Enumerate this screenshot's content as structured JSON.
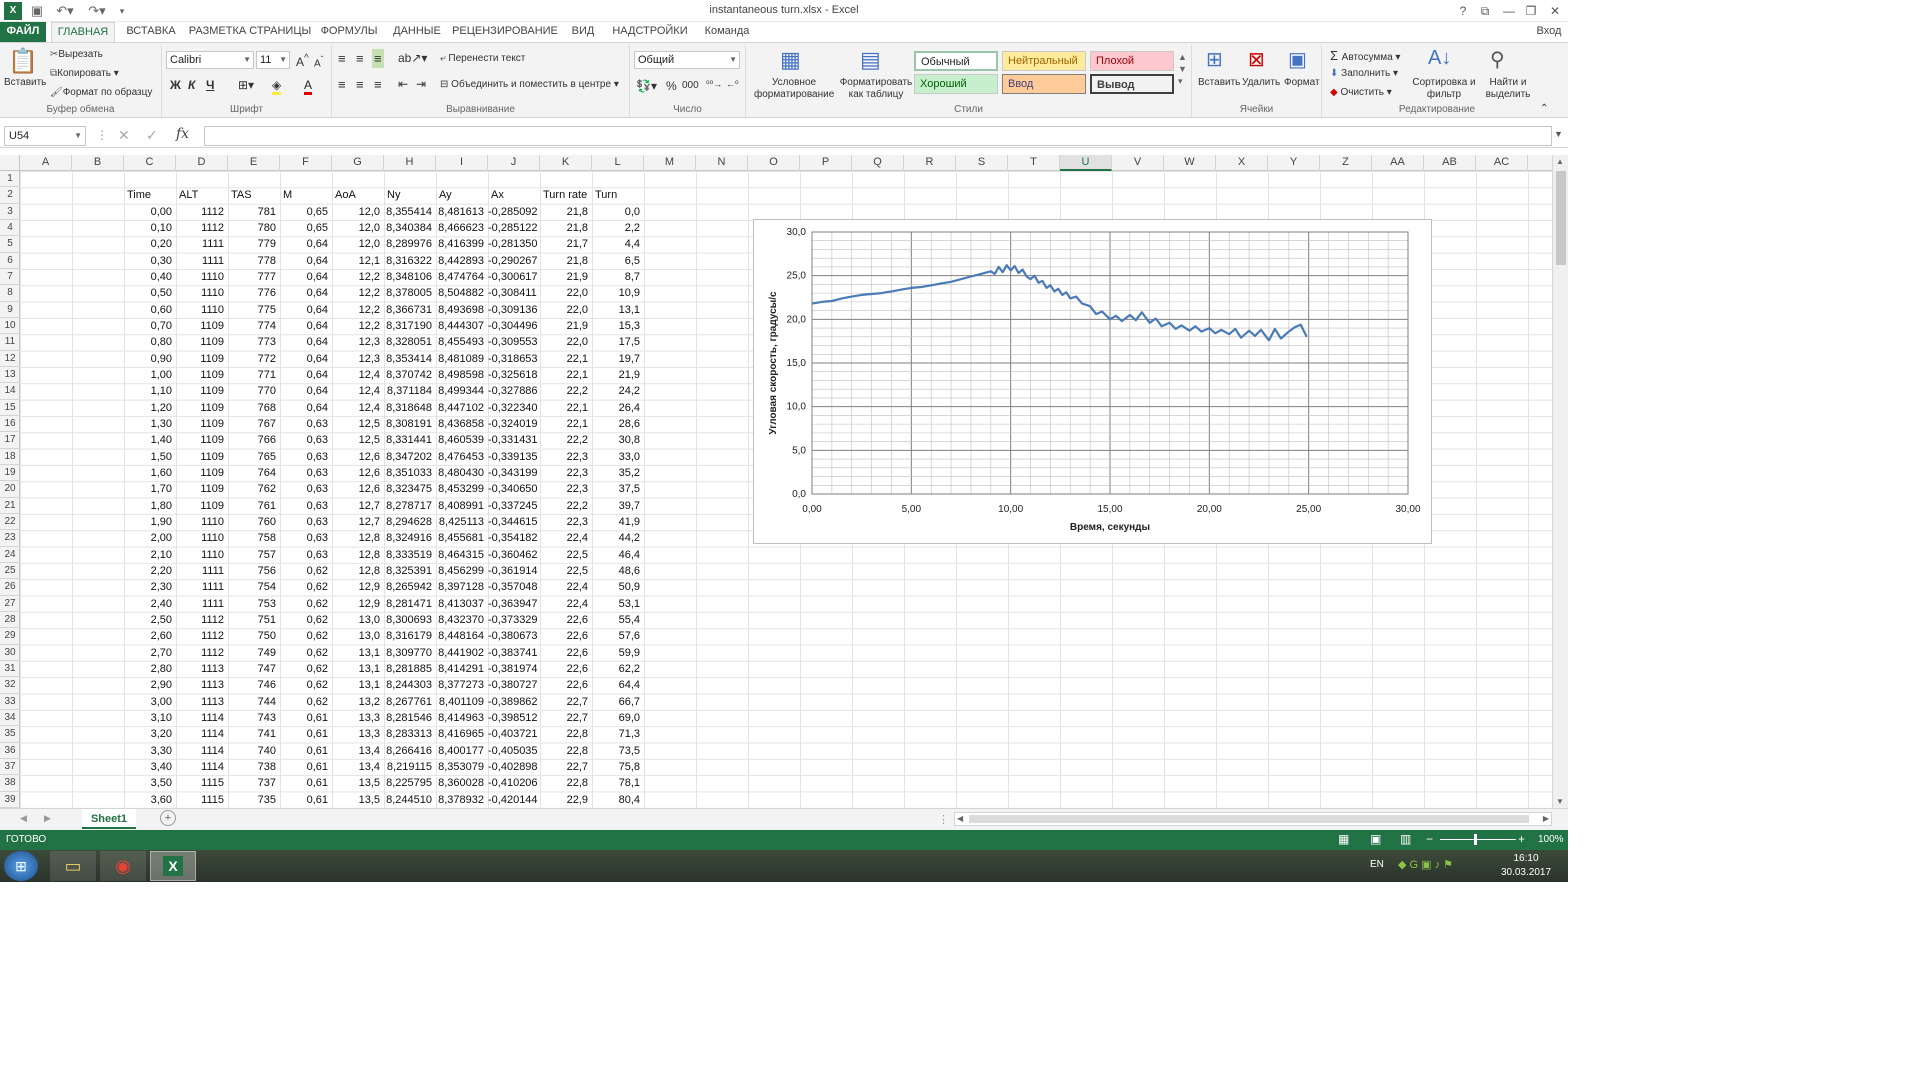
{
  "window": {
    "title": "instantaneous turn.xlsx - Excel",
    "login": "Вход"
  },
  "titlebar_icons": {
    "help": "?",
    "minimize": "—",
    "restore": "❐",
    "close": "✕"
  },
  "tabs": [
    "ФАЙЛ",
    "ГЛАВНАЯ",
    "ВСТАВКА",
    "РАЗМЕТКА СТРАНИЦЫ",
    "ФОРМУЛЫ",
    "ДАННЫЕ",
    "РЕЦЕНЗИРОВАНИЕ",
    "ВИД",
    "НАДСТРОЙКИ",
    "Команда"
  ],
  "ribbon": {
    "clipboard": {
      "paste": "Вставить",
      "cut": "Вырезать",
      "copy": "Копировать",
      "format_painter": "Формат по образцу",
      "group": "Буфер обмена"
    },
    "font": {
      "name": "Calibri",
      "size": "11",
      "bold": "Ж",
      "italic": "К",
      "underline": "Ч",
      "group": "Шрифт"
    },
    "alignment": {
      "wrap": "Перенести текст",
      "merge": "Объединить и поместить в центре",
      "group": "Выравнивание"
    },
    "number": {
      "format": "Общий",
      "percent": "%",
      "thousands": "000",
      "group": "Число"
    },
    "styles": {
      "conditional": "Условное форматирование",
      "as_table": "Форматировать как таблицу",
      "normal": "Обычный",
      "neutral": "Нейтральный",
      "bad": "Плохой",
      "good": "Хороший",
      "input": "Ввод",
      "output": "Вывод",
      "group": "Стили"
    },
    "cells": {
      "insert": "Вставить",
      "delete": "Удалить",
      "format": "Формат",
      "group": "Ячейки"
    },
    "editing": {
      "autosum": "Автосумма",
      "fill": "Заполнить",
      "clear": "Очистить",
      "sort": "Сортировка и фильтр",
      "find": "Найти и выделить",
      "group": "Редактирование"
    }
  },
  "formula_bar": {
    "name_box": "U54",
    "fx": "fx",
    "value": ""
  },
  "columns": [
    "A",
    "B",
    "C",
    "D",
    "E",
    "F",
    "G",
    "H",
    "I",
    "J",
    "K",
    "L",
    "M",
    "N",
    "O",
    "P",
    "Q",
    "R",
    "S",
    "T",
    "U",
    "V",
    "W",
    "X",
    "Y",
    "Z",
    "AA",
    "AB",
    "AC"
  ],
  "selected_column": "U",
  "headers": [
    "Time",
    "ALT",
    "TAS",
    "M",
    "AoA",
    "Ny",
    "Ay",
    "Ax",
    "Turn rate",
    "Turn"
  ],
  "rows": [
    [
      "0,00",
      "1112",
      "781",
      "0,65",
      "12,0",
      "8,355414",
      "8,481613",
      "-0,285092",
      "21,8",
      "0,0"
    ],
    [
      "0,10",
      "1112",
      "780",
      "0,65",
      "12,0",
      "8,340384",
      "8,466623",
      "-0,285122",
      "21,8",
      "2,2"
    ],
    [
      "0,20",
      "1111",
      "779",
      "0,64",
      "12,0",
      "8,289976",
      "8,416399",
      "-0,281350",
      "21,7",
      "4,4"
    ],
    [
      "0,30",
      "1111",
      "778",
      "0,64",
      "12,1",
      "8,316322",
      "8,442893",
      "-0,290267",
      "21,8",
      "6,5"
    ],
    [
      "0,40",
      "1110",
      "777",
      "0,64",
      "12,2",
      "8,348106",
      "8,474764",
      "-0,300617",
      "21,9",
      "8,7"
    ],
    [
      "0,50",
      "1110",
      "776",
      "0,64",
      "12,2",
      "8,378005",
      "8,504882",
      "-0,308411",
      "22,0",
      "10,9"
    ],
    [
      "0,60",
      "1110",
      "775",
      "0,64",
      "12,2",
      "8,366731",
      "8,493698",
      "-0,309136",
      "22,0",
      "13,1"
    ],
    [
      "0,70",
      "1109",
      "774",
      "0,64",
      "12,2",
      "8,317190",
      "8,444307",
      "-0,304496",
      "21,9",
      "15,3"
    ],
    [
      "0,80",
      "1109",
      "773",
      "0,64",
      "12,3",
      "8,328051",
      "8,455493",
      "-0,309553",
      "22,0",
      "17,5"
    ],
    [
      "0,90",
      "1109",
      "772",
      "0,64",
      "12,3",
      "8,353414",
      "8,481089",
      "-0,318653",
      "22,1",
      "19,7"
    ],
    [
      "1,00",
      "1109",
      "771",
      "0,64",
      "12,4",
      "8,370742",
      "8,498598",
      "-0,325618",
      "22,1",
      "21,9"
    ],
    [
      "1,10",
      "1109",
      "770",
      "0,64",
      "12,4",
      "8,371184",
      "8,499344",
      "-0,327886",
      "22,2",
      "24,2"
    ],
    [
      "1,20",
      "1109",
      "768",
      "0,64",
      "12,4",
      "8,318648",
      "8,447102",
      "-0,322340",
      "22,1",
      "26,4"
    ],
    [
      "1,30",
      "1109",
      "767",
      "0,63",
      "12,5",
      "8,308191",
      "8,436858",
      "-0,324019",
      "22,1",
      "28,6"
    ],
    [
      "1,40",
      "1109",
      "766",
      "0,63",
      "12,5",
      "8,331441",
      "8,460539",
      "-0,331431",
      "22,2",
      "30,8"
    ],
    [
      "1,50",
      "1109",
      "765",
      "0,63",
      "12,6",
      "8,347202",
      "8,476453",
      "-0,339135",
      "22,3",
      "33,0"
    ],
    [
      "1,60",
      "1109",
      "764",
      "0,63",
      "12,6",
      "8,351033",
      "8,480430",
      "-0,343199",
      "22,3",
      "35,2"
    ],
    [
      "1,70",
      "1109",
      "762",
      "0,63",
      "12,6",
      "8,323475",
      "8,453299",
      "-0,340650",
      "22,3",
      "37,5"
    ],
    [
      "1,80",
      "1109",
      "761",
      "0,63",
      "12,7",
      "8,278717",
      "8,408991",
      "-0,337245",
      "22,2",
      "39,7"
    ],
    [
      "1,90",
      "1110",
      "760",
      "0,63",
      "12,7",
      "8,294628",
      "8,425113",
      "-0,344615",
      "22,3",
      "41,9"
    ],
    [
      "2,00",
      "1110",
      "758",
      "0,63",
      "12,8",
      "8,324916",
      "8,455681",
      "-0,354182",
      "22,4",
      "44,2"
    ],
    [
      "2,10",
      "1110",
      "757",
      "0,63",
      "12,8",
      "8,333519",
      "8,464315",
      "-0,360462",
      "22,5",
      "46,4"
    ],
    [
      "2,20",
      "1111",
      "756",
      "0,62",
      "12,8",
      "8,325391",
      "8,456299",
      "-0,361914",
      "22,5",
      "48,6"
    ],
    [
      "2,30",
      "1111",
      "754",
      "0,62",
      "12,9",
      "8,265942",
      "8,397128",
      "-0,357048",
      "22,4",
      "50,9"
    ],
    [
      "2,40",
      "1111",
      "753",
      "0,62",
      "12,9",
      "8,281471",
      "8,413037",
      "-0,363947",
      "22,4",
      "53,1"
    ],
    [
      "2,50",
      "1112",
      "751",
      "0,62",
      "13,0",
      "8,300693",
      "8,432370",
      "-0,373329",
      "22,6",
      "55,4"
    ],
    [
      "2,60",
      "1112",
      "750",
      "0,62",
      "13,0",
      "8,316179",
      "8,448164",
      "-0,380673",
      "22,6",
      "57,6"
    ],
    [
      "2,70",
      "1112",
      "749",
      "0,62",
      "13,1",
      "8,309770",
      "8,441902",
      "-0,383741",
      "22,6",
      "59,9"
    ],
    [
      "2,80",
      "1113",
      "747",
      "0,62",
      "13,1",
      "8,281885",
      "8,414291",
      "-0,381974",
      "22,6",
      "62,2"
    ],
    [
      "2,90",
      "1113",
      "746",
      "0,62",
      "13,1",
      "8,244303",
      "8,377273",
      "-0,380727",
      "22,6",
      "64,4"
    ],
    [
      "3,00",
      "1113",
      "744",
      "0,62",
      "13,2",
      "8,267761",
      "8,401109",
      "-0,389862",
      "22,7",
      "66,7"
    ],
    [
      "3,10",
      "1114",
      "743",
      "0,61",
      "13,3",
      "8,281546",
      "8,414963",
      "-0,398512",
      "22,7",
      "69,0"
    ],
    [
      "3,20",
      "1114",
      "741",
      "0,61",
      "13,3",
      "8,283313",
      "8,416965",
      "-0,403721",
      "22,8",
      "71,3"
    ],
    [
      "3,30",
      "1114",
      "740",
      "0,61",
      "13,4",
      "8,266416",
      "8,400177",
      "-0,405035",
      "22,8",
      "73,5"
    ],
    [
      "3,40",
      "1114",
      "738",
      "0,61",
      "13,4",
      "8,219115",
      "8,353079",
      "-0,402898",
      "22,7",
      "75,8"
    ],
    [
      "3,50",
      "1115",
      "737",
      "0,61",
      "13,5",
      "8,225795",
      "8,360028",
      "-0,410206",
      "22,8",
      "78,1"
    ],
    [
      "3,60",
      "1115",
      "735",
      "0,61",
      "13,5",
      "8,244510",
      "8,378932",
      "-0,420144",
      "22,9",
      "80,4"
    ]
  ],
  "chart_data": {
    "type": "line",
    "title": "",
    "xlabel": "Время, секунды",
    "ylabel": "Угловая скорость, градусы/с",
    "xlim": [
      0,
      30
    ],
    "ylim": [
      0,
      30
    ],
    "x_ticks": [
      "0,00",
      "5,00",
      "10,00",
      "15,00",
      "20,00",
      "25,00",
      "30,00"
    ],
    "y_ticks": [
      "0,0",
      "5,0",
      "10,0",
      "15,0",
      "20,0",
      "25,0",
      "30,0"
    ],
    "grid": true,
    "color": "#4a7ab8",
    "series": [
      {
        "x": [
          0,
          0.5,
          1,
          1.5,
          2,
          2.5,
          3,
          3.5,
          4,
          4.5,
          5,
          5.5,
          6,
          6.5,
          7,
          7.5,
          8,
          8.5,
          9,
          9.2,
          9.4,
          9.6,
          9.8,
          10,
          10.2,
          10.4,
          10.6,
          10.8,
          11,
          11.2,
          11.4,
          11.6,
          11.8,
          12,
          12.2,
          12.4,
          12.6,
          12.8,
          13,
          13.3,
          13.6,
          14,
          14.3,
          14.6,
          15,
          15.3,
          15.6,
          16,
          16.3,
          16.6,
          17,
          17.3,
          17.6,
          18,
          18.3,
          18.6,
          19,
          19.3,
          19.6,
          20,
          20.3,
          20.6,
          21,
          21.3,
          21.6,
          22,
          22.3,
          22.6,
          23,
          23.3,
          23.6,
          24,
          24.3,
          24.6,
          24.9
        ],
        "y": [
          21.8,
          22.0,
          22.1,
          22.4,
          22.6,
          22.8,
          22.9,
          23.0,
          23.2,
          23.4,
          23.6,
          23.7,
          23.9,
          24.1,
          24.3,
          24.6,
          24.9,
          25.2,
          25.5,
          25.2,
          26.0,
          25.4,
          26.2,
          25.6,
          26.1,
          25.3,
          25.7,
          24.9,
          24.6,
          25.0,
          24.2,
          24.4,
          23.6,
          23.9,
          23.2,
          23.5,
          22.8,
          23.1,
          22.4,
          22.6,
          21.8,
          21.5,
          20.6,
          20.9,
          20.0,
          20.4,
          19.8,
          20.5,
          19.9,
          20.8,
          19.6,
          20.1,
          19.2,
          19.6,
          18.9,
          19.3,
          18.7,
          19.2,
          18.6,
          19.0,
          18.4,
          18.8,
          18.3,
          18.9,
          17.9,
          18.7,
          18.1,
          18.8,
          17.6,
          18.9,
          17.8,
          18.6,
          19.1,
          19.4,
          18.0
        ]
      }
    ]
  },
  "sheet_tab": "Sheet1",
  "status": {
    "ready": "ГОТОВО",
    "zoom": "100%"
  },
  "taskbar": {
    "lang": "EN",
    "time": "16:10",
    "date": "30.03.2017"
  }
}
